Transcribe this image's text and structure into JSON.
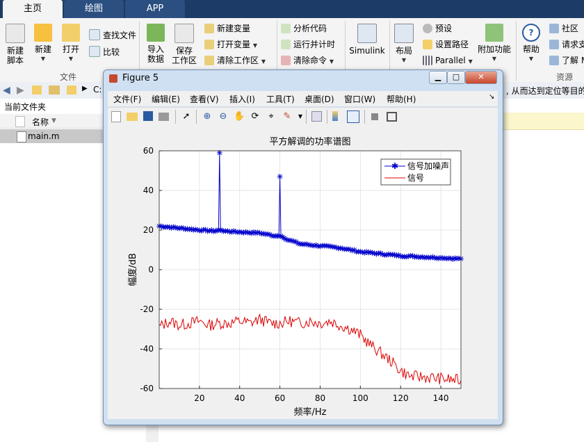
{
  "app": {
    "tabs": [
      "主页",
      "绘图",
      "APP"
    ],
    "ribbon": {
      "new_script": "新建\n脚本",
      "new": "新建",
      "open": "打开",
      "find_files": "查找文件",
      "compare": "比较",
      "import": "导入\n数据",
      "save_ws": "保存\n工作区",
      "new_var": "新建变量",
      "open_var": "打开变量",
      "clear_ws": "清除工作区",
      "analyze": "分析代码",
      "run_time": "运行并计时",
      "clear_cmd": "清除命令",
      "simulink": "Simulink",
      "layout": "布局",
      "prefs": "预设",
      "set_path": "设置路径",
      "parallel": "Parallel",
      "addons": "附加功能",
      "help": "帮助",
      "community": "社区",
      "request": "请求支",
      "learn": "了解 M",
      "group_file": "文件",
      "group_resources": "资源"
    },
    "nav": {
      "path": "C:",
      "hint": "从而达到定位等目的"
    },
    "file_panel": {
      "title": "当前文件夹",
      "col_name": "名称",
      "file": "main.m"
    }
  },
  "figure": {
    "title": "Figure 5",
    "menus": [
      "文件(F)",
      "编辑(E)",
      "查看(V)",
      "插入(I)",
      "工具(T)",
      "桌面(D)",
      "窗口(W)",
      "帮助(H)"
    ]
  },
  "colors": {
    "signal_noise": "#0000cc",
    "signal": "#dd0000",
    "ribbon_bg": "#f4f4f4",
    "tab_bg": "#1c3b66"
  },
  "chart_data": {
    "type": "line",
    "title": "平方解调的功率谱图",
    "xlabel": "频率/Hz",
    "ylabel": "幅度/dB",
    "xlim": [
      0,
      150
    ],
    "ylim": [
      -60,
      60
    ],
    "xticks": [
      20,
      40,
      60,
      80,
      100,
      120,
      140
    ],
    "yticks": [
      60,
      40,
      20,
      0,
      -20,
      -40,
      -60
    ],
    "grid": true,
    "legend_position": "top-right",
    "series": [
      {
        "name": "信号加噪声",
        "marker": "*",
        "x": [
          0,
          10,
          20,
          28,
          29.5,
          30,
          30.5,
          32,
          40,
          50,
          58,
          59.5,
          60,
          60.5,
          62,
          70,
          80,
          90,
          100,
          110,
          120,
          130,
          140,
          150
        ],
        "y": [
          22,
          21,
          20,
          19.5,
          20,
          59,
          20,
          19.5,
          19,
          18.5,
          17,
          17,
          47,
          17,
          16,
          13,
          12,
          11,
          9,
          8,
          7,
          6.5,
          6,
          5.5
        ]
      },
      {
        "name": "信号",
        "marker": "none",
        "x": [
          0,
          5,
          10,
          15,
          20,
          25,
          30,
          35,
          40,
          45,
          50,
          55,
          60,
          65,
          70,
          75,
          80,
          85,
          90,
          95,
          100,
          105,
          110,
          115,
          120,
          125,
          130,
          135,
          140,
          145,
          150
        ],
        "y": [
          -29,
          -26,
          -28,
          -27,
          -26,
          -28,
          -27,
          -27,
          -26,
          -27,
          -25,
          -27,
          -27,
          -26,
          -27,
          -26,
          -27,
          -26,
          -28,
          -30,
          -33,
          -38,
          -42,
          -46,
          -51,
          -54,
          -54,
          -54.5,
          -55,
          -55.5,
          -56
        ]
      }
    ]
  }
}
